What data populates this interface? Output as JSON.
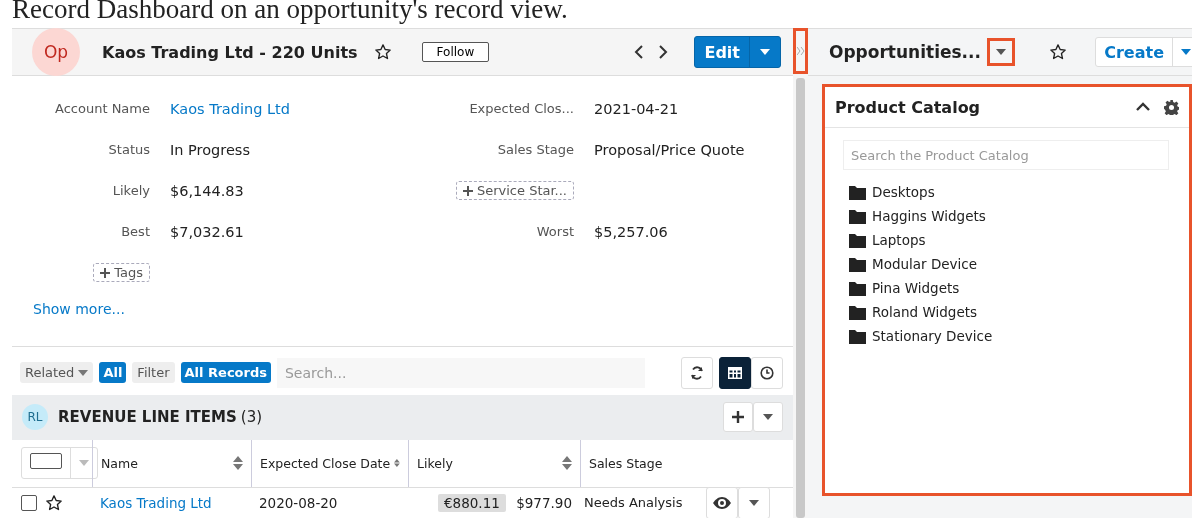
{
  "caption": "Record Dashboard on an opportunity's record view.",
  "record": {
    "avatar": "Op",
    "title": "Kaos Trading Ltd - 220 Units",
    "favorite": false,
    "follow_button": "Follow",
    "edit_button": "Edit"
  },
  "field_rows": [
    [
      {
        "kind": "field",
        "label": "Account Name",
        "value": "Kaos Trading Ltd",
        "link": true
      },
      {
        "kind": "field",
        "label": "Expected Clos...",
        "value": "2021-04-21",
        "link": false
      }
    ],
    [
      {
        "kind": "field",
        "label": "Status",
        "value": "In Progress",
        "link": false
      },
      {
        "kind": "field",
        "label": "Sales Stage",
        "value": "Proposal/Price Quote",
        "link": false
      }
    ],
    [
      {
        "kind": "field",
        "label": "Likely",
        "value": "$6,144.83",
        "link": false
      },
      {
        "kind": "add",
        "label": "Service Star..."
      }
    ],
    [
      {
        "kind": "field",
        "label": "Best",
        "value": "$7,032.61",
        "link": false
      },
      {
        "kind": "field",
        "label": "Worst",
        "value": "$5,257.06",
        "link": false
      }
    ],
    [
      {
        "kind": "add",
        "label": "Tags"
      }
    ]
  ],
  "show_more": "Show more...",
  "subpanel_toolbar": {
    "related": "Related",
    "related_value": "All",
    "filter": "Filter",
    "filter_value": "All Records",
    "search_placeholder": "Search...",
    "views": [
      {
        "kind": "list",
        "selected": true
      },
      {
        "kind": "timeline",
        "selected": false
      }
    ]
  },
  "subpanel": {
    "avatar": "RL",
    "title": "REVENUE LINE ITEMS",
    "count": "(3)",
    "columns": [
      {
        "label": "Name",
        "sortable": true
      },
      {
        "label": "Expected Close Date",
        "sortable": true
      },
      {
        "label": "Likely",
        "sortable": true
      },
      {
        "label": "Sales Stage",
        "sortable": false
      }
    ],
    "select_all_checked": false,
    "rows": [
      {
        "checked": false,
        "favorite": false,
        "name": "Kaos Trading Ltd",
        "expected_close_date": "2020-08-20",
        "likely_converted": "€880.11",
        "likely": "$977.90",
        "sales_stage": "Needs Analysis"
      }
    ]
  },
  "dashboard": {
    "title": "Opportunities...",
    "favorite": false,
    "create_button": "Create",
    "handle_highlighted": true,
    "dropdown_highlighted": true,
    "dashlet_highlighted": true,
    "dashlet": {
      "title": "Product Catalog",
      "search_placeholder": "Search the Product Catalog",
      "folders": [
        "Desktops",
        "Haggins Widgets",
        "Laptops",
        "Modular Device",
        "Pina Widgets",
        "Roland Widgets",
        "Stationary Device"
      ]
    }
  }
}
